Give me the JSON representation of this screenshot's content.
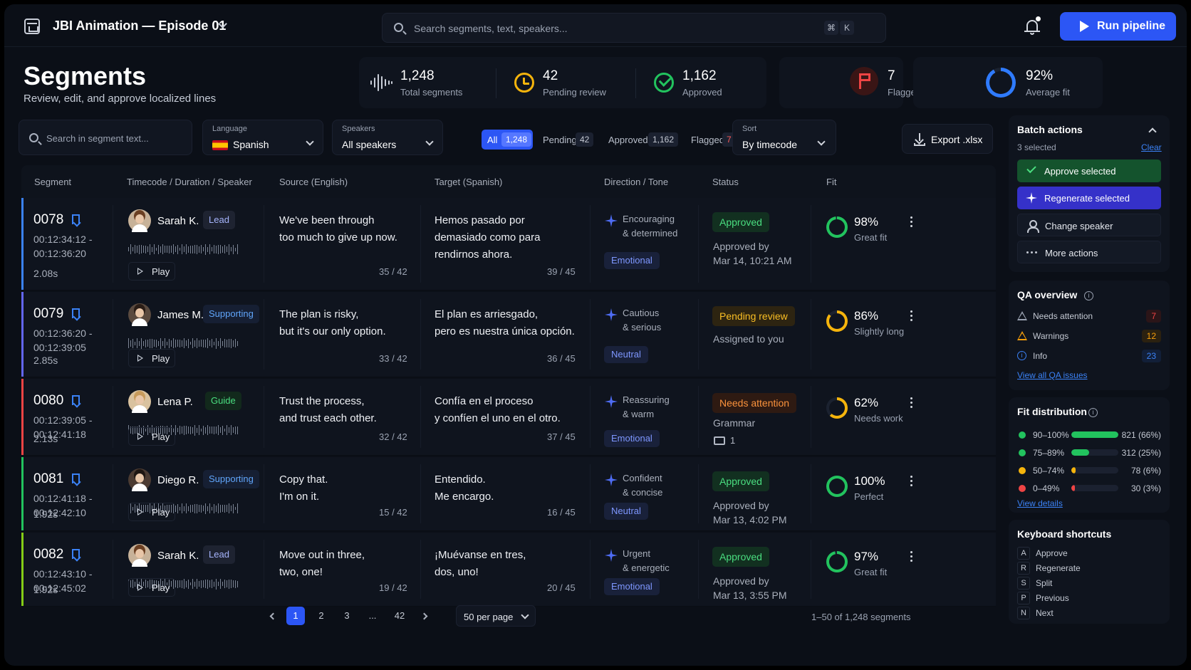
{
  "app": {
    "project_title": "JBI Animation — Episode 01",
    "search_placeholder": "Search segments, text, speakers...",
    "shortcut_keys": [
      "⌘",
      "K"
    ],
    "run_label": "Run pipeline"
  },
  "header": {
    "title": "Segments",
    "subtitle": "Review, edit, and approve localized lines"
  },
  "stats": [
    {
      "value": "1,248",
      "label": "Total segments",
      "icon": "waveform-icon"
    },
    {
      "value": "42",
      "label": "Pending review",
      "icon": "clock-icon"
    },
    {
      "value": "1,162",
      "label": "Approved",
      "icon": "check-circle-icon"
    },
    {
      "value": "7",
      "label": "Flagged",
      "icon": "flag-icon"
    },
    {
      "value": "92%",
      "label": "Average fit",
      "icon": "progress-ring-icon",
      "fraction": 0.92
    }
  ],
  "filters": {
    "search_placeholder": "Search in segment text...",
    "language": {
      "caption": "Language",
      "value": "Spanish"
    },
    "speakers": {
      "caption": "Speakers",
      "value": "All speakers"
    },
    "tabs": [
      {
        "label": "All",
        "count": "1,248",
        "active": true
      },
      {
        "label": "Pending",
        "count": "42"
      },
      {
        "label": "Approved",
        "count": "1,162"
      },
      {
        "label": "Flagged",
        "count": "7"
      }
    ],
    "sort": {
      "caption": "Sort",
      "value": "By timecode"
    },
    "export_label": "Export .xlsx"
  },
  "table": {
    "columns": [
      "Segment",
      "Timecode / Duration / Speaker",
      "Source (English)",
      "Target (Spanish)",
      "Direction / Tone",
      "Status",
      "Fit"
    ],
    "rows": [
      {
        "id": "0078",
        "tc_start": "00:12:34:12 -",
        "tc_end": "00:12:36:20",
        "duration": "2.08s",
        "speaker": "Sarah K.",
        "role": "Lead",
        "role_kind": "lead",
        "avatar": "f",
        "play": "Play",
        "source": [
          "We've been through",
          "too much to give up now."
        ],
        "source_count": "35 / 42",
        "target": [
          "Hemos pasado por",
          "demasiado como para",
          "rendirnos ahora."
        ],
        "target_count": "39 / 45",
        "direction": [
          "Encouraging",
          "& determined"
        ],
        "tone": "Emotional",
        "status": "Approved",
        "status_kind": "approved",
        "meta": [
          "Approved by",
          "Mar 14, 10:21 AM"
        ],
        "fit": "98%",
        "fit_label": "Great fit",
        "fit_value": 0.98,
        "fit_color": "#22c35e",
        "bar_color": "#3b82f6"
      },
      {
        "id": "0079",
        "tc_start": "00:12:36:20 -",
        "tc_end": "00:12:39:05",
        "duration": "2.85s",
        "speaker": "James M.",
        "role": "Supporting",
        "role_kind": "sup",
        "avatar": "m",
        "play": "Play",
        "source": [
          "The plan is risky,",
          "but it's our only option."
        ],
        "source_count": "33 / 42",
        "target": [
          "El plan es arriesgado,",
          "pero es nuestra única opción."
        ],
        "target_count": "36 / 45",
        "direction": [
          "Cautious",
          "& serious"
        ],
        "tone": "Neutral",
        "status": "Pending review",
        "status_kind": "pending",
        "meta": [
          "Assigned to you"
        ],
        "fit": "86%",
        "fit_label": "Slightly long",
        "fit_value": 0.86,
        "fit_color": "#f5b40c",
        "bar_color": "#6366f1"
      },
      {
        "id": "0080",
        "tc_start": "00:12:39:05 -",
        "tc_end": "00:12:41:18",
        "duration": "2.13s",
        "speaker": "Lena P.",
        "role": "Guide",
        "role_kind": "guide",
        "avatar": "f2",
        "play": "Play",
        "source": [
          "Trust the process,",
          "and trust each other."
        ],
        "source_count": "32 / 42",
        "target": [
          "Confía en el proceso",
          "y confíen el uno en el otro."
        ],
        "target_count": "37 / 45",
        "direction": [
          "Reassuring",
          "& warm"
        ],
        "tone": "Emotional",
        "status": "Needs attention",
        "status_kind": "attn",
        "meta": [
          "Grammar"
        ],
        "comments": "1",
        "fit": "62%",
        "fit_label": "Needs work",
        "fit_value": 0.62,
        "fit_color": "#f5b40c",
        "bar_color": "#ef4444"
      },
      {
        "id": "0081",
        "tc_start": "00:12:41:18 -",
        "tc_end": "00:12:42:10",
        "duration": "1.92s",
        "speaker": "Diego R.",
        "role": "Supporting",
        "role_kind": "sup",
        "avatar": "m2",
        "play": "Play",
        "source": [
          "Copy that.",
          "I'm on it."
        ],
        "source_count": "15 / 42",
        "target": [
          "Entendido.",
          "Me encargo."
        ],
        "target_count": "16 / 45",
        "direction": [
          "Confident",
          "& concise"
        ],
        "tone": "Neutral",
        "status": "Approved",
        "status_kind": "approved",
        "meta": [
          "Approved by",
          "Mar 13, 4:02 PM"
        ],
        "fit": "100%",
        "fit_label": "Perfect",
        "fit_value": 1.0,
        "fit_color": "#22c35e",
        "bar_color": "#22c35e"
      },
      {
        "id": "0082",
        "tc_start": "00:12:43:10 -",
        "tc_end": "00:12:45:02",
        "duration": "1.92s",
        "speaker": "Sarah K.",
        "role": "Lead",
        "role_kind": "lead",
        "avatar": "f",
        "play": "Play",
        "source": [
          "Move out in three,",
          "two, one!"
        ],
        "source_count": "19 / 42",
        "target": [
          "¡Muévanse en tres,",
          "dos, uno!"
        ],
        "target_count": "20 / 45",
        "direction": [
          "Urgent",
          "& energetic"
        ],
        "tone": "Emotional",
        "status": "Approved",
        "status_kind": "approved",
        "meta": [
          "Approved by",
          "Mar 13, 3:55 PM"
        ],
        "fit": "97%",
        "fit_label": "Great fit",
        "fit_value": 0.97,
        "fit_color": "#22c35e",
        "bar_color": "#84cc16"
      }
    ]
  },
  "pagination": {
    "pages": [
      "1",
      "2",
      "3",
      "...",
      "42"
    ],
    "per_page": "50 per page",
    "info": "1–50 of 1,248 segments"
  },
  "batch": {
    "title": "Batch actions",
    "selected": "3 selected",
    "clear": "Clear",
    "approve": "Approve selected",
    "regenerate": "Regenerate selected",
    "change_speaker": "Change speaker",
    "more": "More actions"
  },
  "qa": {
    "title": "QA overview",
    "items": [
      {
        "label": "Needs attention",
        "count": "7",
        "color": "#ef4444"
      },
      {
        "label": "Warnings",
        "count": "12",
        "color": "#f59e0b"
      },
      {
        "label": "Info",
        "count": "23",
        "color": "#3b82f6"
      }
    ],
    "link": "View all QA issues"
  },
  "fit_dist": {
    "title": "Fit distribution",
    "items": [
      {
        "label": "90–100%",
        "value": "821 (66%)",
        "fraction": 0.66,
        "color": "#22c35e"
      },
      {
        "label": "75–89%",
        "value": "312 (25%)",
        "fraction": 0.25,
        "color": "#22c35e"
      },
      {
        "label": "50–74%",
        "value": "78 (6%)",
        "fraction": 0.06,
        "color": "#f5b40c"
      },
      {
        "label": "0–49%",
        "value": "30 (3%)",
        "fraction": 0.03,
        "color": "#ef4444"
      }
    ],
    "link": "View details"
  },
  "shortcuts": {
    "title": "Keyboard shortcuts",
    "items": [
      {
        "key": "A",
        "label": "Approve"
      },
      {
        "key": "R",
        "label": "Regenerate"
      },
      {
        "key": "S",
        "label": "Split"
      },
      {
        "key": "P",
        "label": "Previous"
      },
      {
        "key": "N",
        "label": "Next"
      }
    ]
  }
}
